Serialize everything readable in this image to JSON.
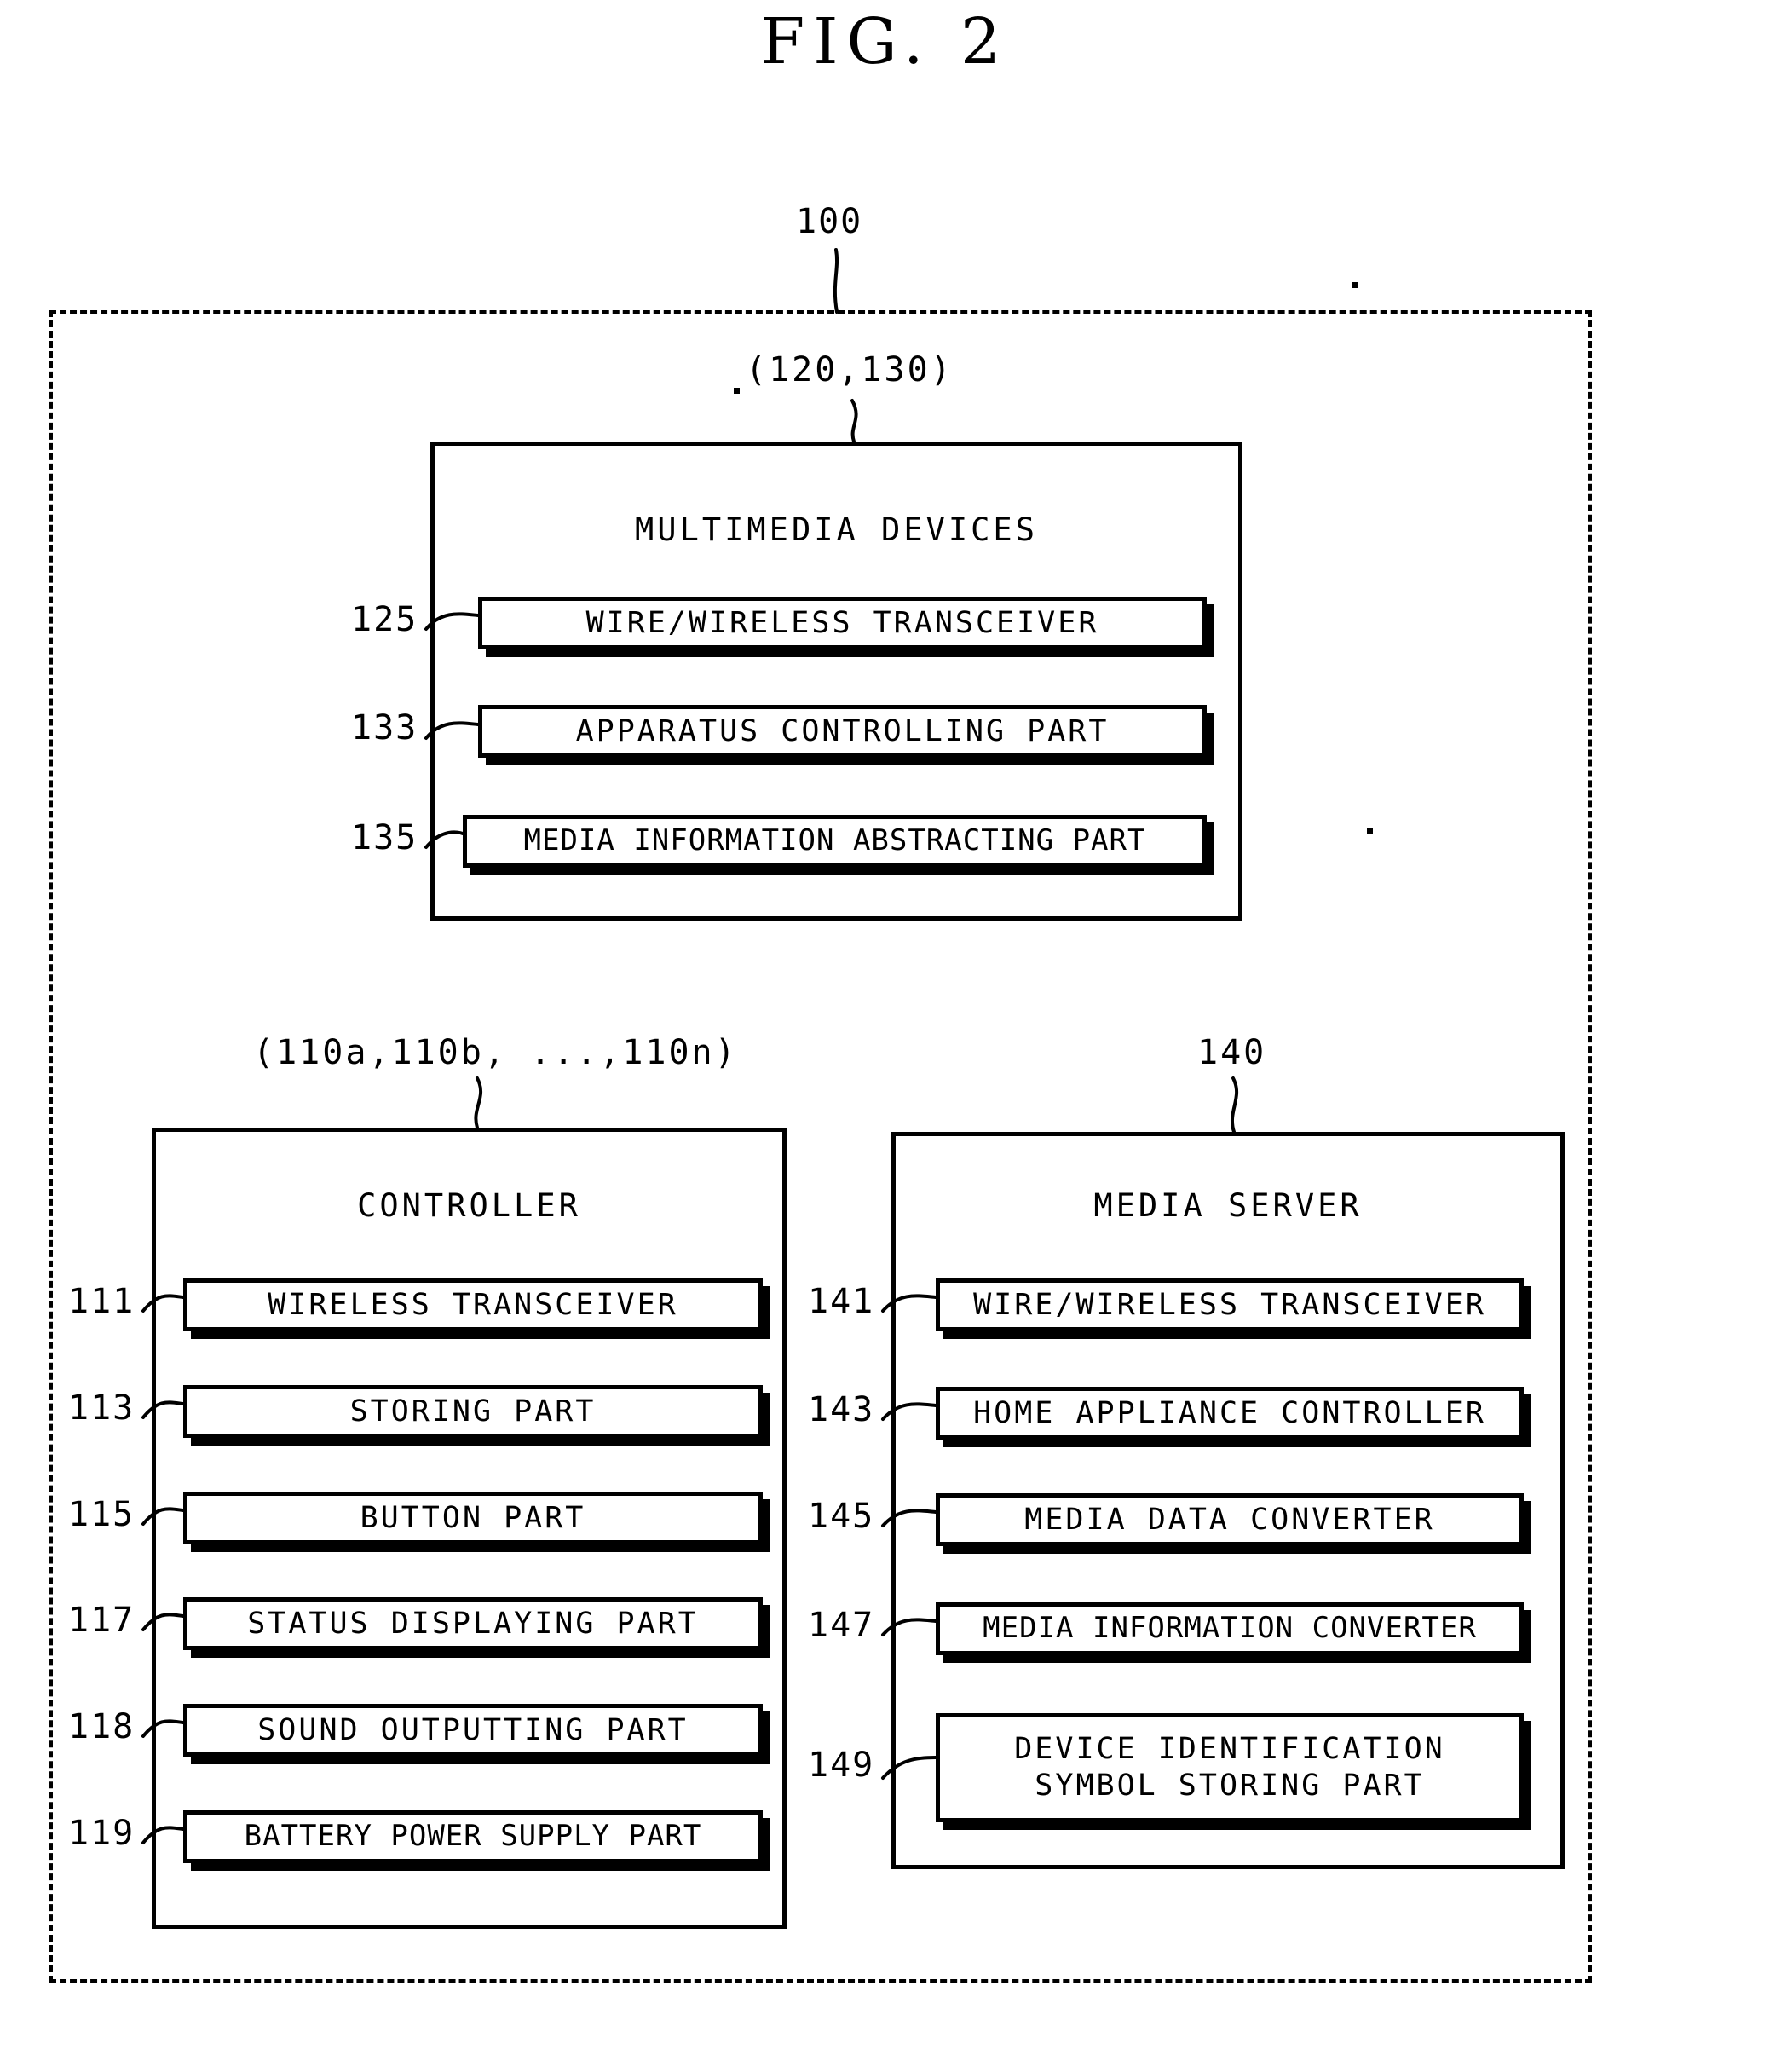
{
  "figure": {
    "title": "FIG. 2",
    "system_ref": "100"
  },
  "multimedia": {
    "callout": "(120,130)",
    "title": "MULTIMEDIA DEVICES",
    "components": [
      {
        "ref": "125",
        "label": "WIRE/WIRELESS TRANSCEIVER"
      },
      {
        "ref": "133",
        "label": "APPARATUS CONTROLLING PART"
      },
      {
        "ref": "135",
        "label": "MEDIA INFORMATION ABSTRACTING PART"
      }
    ]
  },
  "controller": {
    "callout": "(110a,110b, ...,110n)",
    "title": "CONTROLLER",
    "components": [
      {
        "ref": "111",
        "label": "WIRELESS TRANSCEIVER"
      },
      {
        "ref": "113",
        "label": "STORING PART"
      },
      {
        "ref": "115",
        "label": "BUTTON PART"
      },
      {
        "ref": "117",
        "label": "STATUS DISPLAYING PART"
      },
      {
        "ref": "118",
        "label": "SOUND OUTPUTTING PART"
      },
      {
        "ref": "119",
        "label": "BATTERY POWER SUPPLY PART"
      }
    ]
  },
  "media_server": {
    "callout": "140",
    "title": "MEDIA SERVER",
    "components": [
      {
        "ref": "141",
        "label": "WIRE/WIRELESS TRANSCEIVER"
      },
      {
        "ref": "143",
        "label": "HOME APPLIANCE CONTROLLER"
      },
      {
        "ref": "145",
        "label": "MEDIA DATA CONVERTER"
      },
      {
        "ref": "147",
        "label": "MEDIA INFORMATION CONVERTER"
      },
      {
        "ref": "149",
        "label": "DEVICE IDENTIFICATION\nSYMBOL STORING PART"
      }
    ]
  },
  "colors": {
    "ink": "#000000",
    "paper": "#ffffff"
  }
}
